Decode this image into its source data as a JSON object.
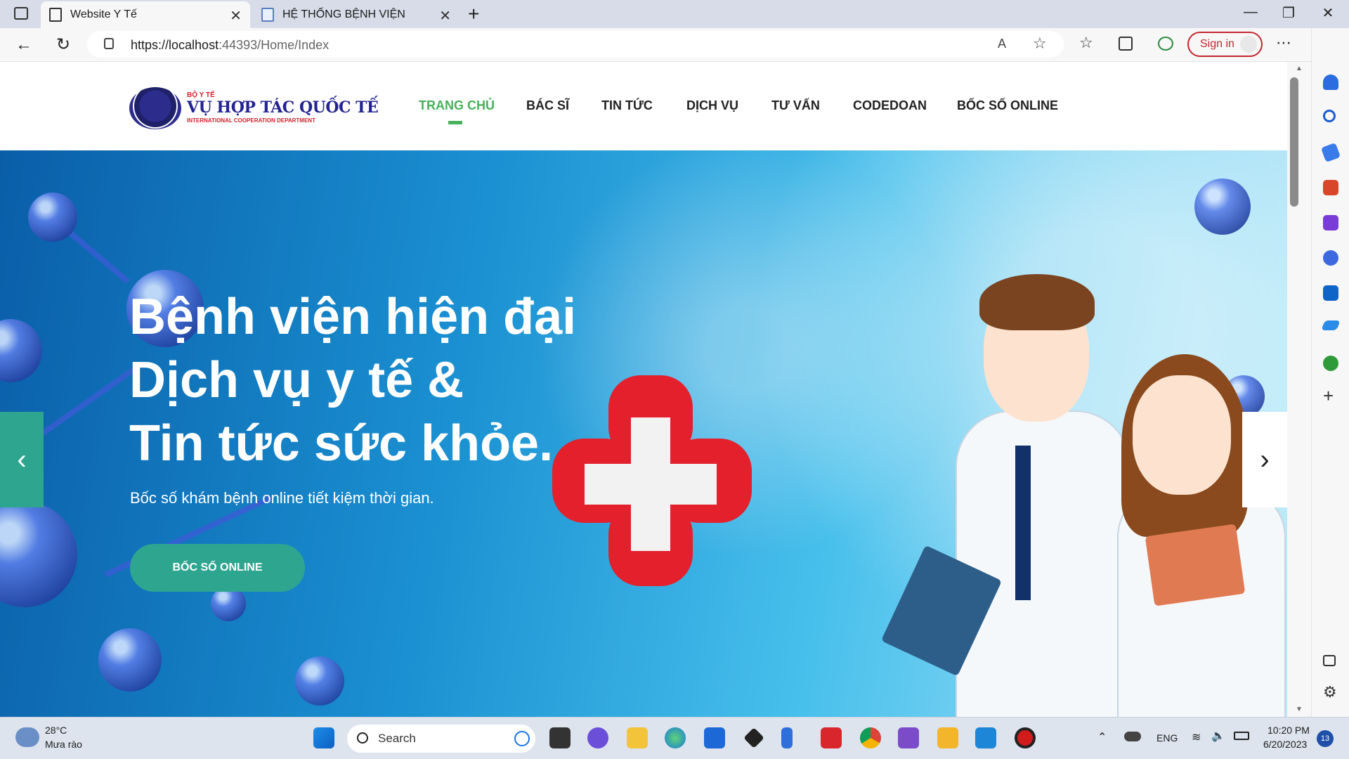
{
  "browser": {
    "tabs": [
      {
        "label": "Website Y Tế",
        "active": true
      },
      {
        "label": "HỆ THỐNG BỆNH VIỆN",
        "active": false
      }
    ],
    "url_scheme_host": "https://localhost",
    "url_rest": ":44393/Home/Index",
    "sign_in_label": "Sign in"
  },
  "site": {
    "logo_small": "BỘ Y TẾ",
    "logo_main": "VỤ HỢP TÁC QUỐC TẾ",
    "logo_sub": "INTERNATIONAL COOPERATION DEPARTMENT",
    "nav": [
      {
        "label": "TRANG CHỦ",
        "active": true
      },
      {
        "label": "BÁC SĨ",
        "active": false
      },
      {
        "label": "TIN TỨC",
        "active": false
      },
      {
        "label": "DỊCH VỤ",
        "active": false
      },
      {
        "label": "TƯ VẤN",
        "active": false
      },
      {
        "label": "CODEDOAN",
        "active": false
      },
      {
        "label": "BỐC SỐ ONLINE",
        "active": false
      }
    ]
  },
  "hero": {
    "line1": "Bệnh viện hiện đại",
    "line2": "Dịch vụ y tế &",
    "line3": "Tin tức sức khỏe.",
    "subtitle": "Bốc số khám bệnh online tiết kiệm thời gian.",
    "button": "BỐC SỐ ONLINE",
    "prev_arrow": "‹",
    "next_arrow": "›"
  },
  "taskbar": {
    "weather_temp": "28°C",
    "weather_desc": "Mưa rào",
    "search_label": "Search",
    "language": "ENG",
    "time": "10:20 PM",
    "date": "6/20/2023",
    "notification_count": "13"
  },
  "colors": {
    "accent_green": "#48b05a",
    "teal_button": "#2ea58f",
    "cross_red": "#e3202c",
    "signin_red": "#c4262e"
  }
}
